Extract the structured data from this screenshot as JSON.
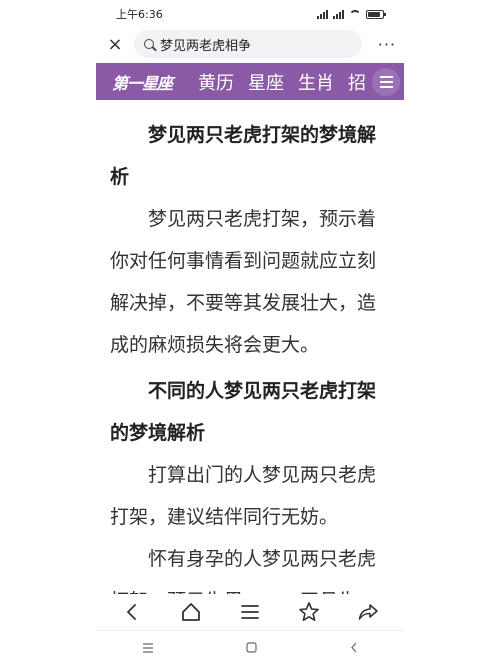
{
  "status": {
    "time": "上午6:36",
    "signal1": "HD",
    "signal2": "HD"
  },
  "browser": {
    "query": "梦见两老虎相争",
    "close": "×",
    "more": "···"
  },
  "nav": {
    "logo": "第一星座",
    "items": [
      "黄历",
      "星座",
      "生肖",
      "招"
    ]
  },
  "article": {
    "h1": "梦见两只老虎打架的梦境解析",
    "p1": "梦见两只老虎打架，预示着你对任何事情看到问题就应立刻解决掉，不要等其发展壮大，造成的麻烦损失将会更大。",
    "h2": "不同的人梦见两只老虎打架的梦境解析",
    "p2": "打算出门的人梦见两只老虎打架，建议结伴同行无妨。",
    "p3": "怀有身孕的人梦见两只老虎打架，预示生男，二、四月生"
  }
}
